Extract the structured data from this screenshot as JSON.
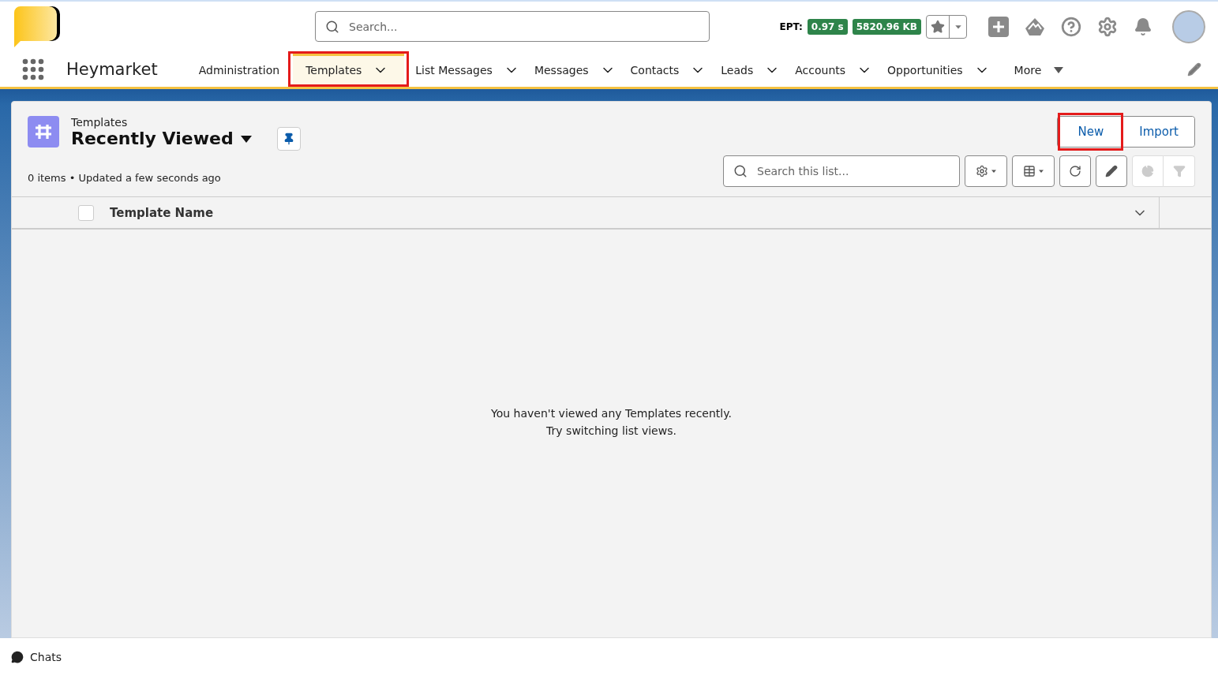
{
  "header": {
    "search": {
      "placeholder": "Search..."
    },
    "ept_label": "EPT:",
    "ept_badges": [
      "0.97 s",
      "5820.96 KB"
    ]
  },
  "nav": {
    "app_name": "Heymarket",
    "items": [
      {
        "label": "Administration",
        "selected": false,
        "has_menu": false,
        "highlighted": false
      },
      {
        "label": "Templates",
        "selected": true,
        "has_menu": true,
        "highlighted": true
      },
      {
        "label": "List Messages",
        "selected": false,
        "has_menu": true,
        "highlighted": false
      },
      {
        "label": "Messages",
        "selected": false,
        "has_menu": true,
        "highlighted": false
      },
      {
        "label": "Contacts",
        "selected": false,
        "has_menu": true,
        "highlighted": false
      },
      {
        "label": "Leads",
        "selected": false,
        "has_menu": true,
        "highlighted": false
      },
      {
        "label": "Accounts",
        "selected": false,
        "has_menu": true,
        "highlighted": false
      },
      {
        "label": "Opportunities",
        "selected": false,
        "has_menu": true,
        "highlighted": false
      }
    ],
    "more": "More"
  },
  "list_view": {
    "object": "Templates",
    "view": "Recently Viewed",
    "status": "0 items • Updated a few seconds ago",
    "actions": [
      {
        "label": "New",
        "highlighted": true
      },
      {
        "label": "Import",
        "highlighted": false
      }
    ],
    "search": {
      "placeholder": "Search this list..."
    },
    "select_all_checked": false,
    "columns": [
      "Template Name"
    ],
    "empty": [
      "You haven't viewed any Templates recently.",
      "Try switching list views."
    ]
  },
  "footer": {
    "label": "Chats"
  }
}
